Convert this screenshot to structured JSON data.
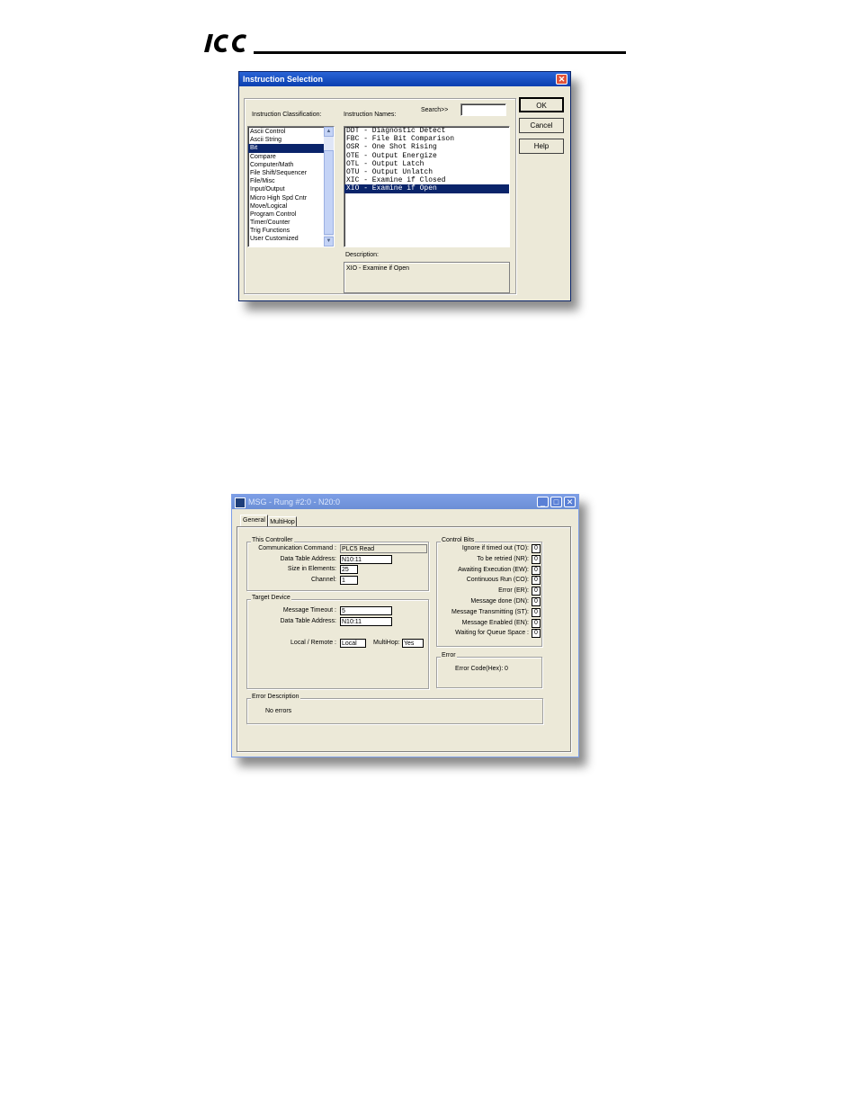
{
  "header": {
    "logo_text": "ICC"
  },
  "instruction_dialog": {
    "title": "Instruction Selection",
    "classification_label": "Instruction Classification:",
    "names_label": "Instruction Names:",
    "search_label": "Search>>",
    "search_value": "",
    "classifications": [
      {
        "label": "Ascii Control",
        "selected": false
      },
      {
        "label": "Ascii String",
        "selected": false
      },
      {
        "label": "Bit",
        "selected": true
      },
      {
        "label": "Compare",
        "selected": false
      },
      {
        "label": "Computer/Math",
        "selected": false
      },
      {
        "label": "File Shift/Sequencer",
        "selected": false
      },
      {
        "label": "File/Misc",
        "selected": false
      },
      {
        "label": "Input/Output",
        "selected": false
      },
      {
        "label": "Micro High Spd Cntr",
        "selected": false
      },
      {
        "label": "Move/Logical",
        "selected": false
      },
      {
        "label": "Program Control",
        "selected": false
      },
      {
        "label": "Timer/Counter",
        "selected": false
      },
      {
        "label": "Trig Functions",
        "selected": false
      },
      {
        "label": "User Customized",
        "selected": false
      }
    ],
    "instructions": [
      {
        "label": "DDT - Diagnostic Detect",
        "selected": false
      },
      {
        "label": "FBC - File Bit Comparison",
        "selected": false
      },
      {
        "label": "OSR - One Shot Rising",
        "selected": false
      },
      {
        "label": "OTE - Output Energize",
        "selected": false
      },
      {
        "label": "OTL - Output Latch",
        "selected": false
      },
      {
        "label": "OTU - Output Unlatch",
        "selected": false
      },
      {
        "label": "XIC - Examine if Closed",
        "selected": false
      },
      {
        "label": "XIO - Examine if Open",
        "selected": true
      }
    ],
    "description_label": "Description:",
    "description_text": "XIO - Examine if Open",
    "buttons": {
      "ok": "OK",
      "cancel": "Cancel",
      "help": "Help"
    },
    "close_glyph": "✕"
  },
  "msg_dialog": {
    "title": "MSG - Rung #2:0 - N20:0",
    "tabs": [
      "General",
      "MultiHop"
    ],
    "this_controller": {
      "legend": "This Controller",
      "fields": [
        {
          "label": "Communication Command :",
          "value": "PLC5 Read"
        },
        {
          "label": "Data Table Address:",
          "value": "N10:11"
        },
        {
          "label": "Size in Elements:",
          "value": "25"
        },
        {
          "label": "Channel:",
          "value": "1"
        }
      ]
    },
    "target_device": {
      "legend": "Target Device",
      "timeout_label": "Message Timeout :",
      "timeout_value": "5",
      "address_label": "Data Table Address:",
      "address_value": "N10:11",
      "local_remote_label": "Local / Remote :",
      "local_remote_value": "Local",
      "multihop_label": "MultiHop:",
      "multihop_value": "Yes"
    },
    "control_bits": {
      "legend": "Control Bits",
      "bits": [
        {
          "label": "Ignore if timed out (TO):",
          "value": "0"
        },
        {
          "label": "To be retried (NR):",
          "value": "0"
        },
        {
          "label": "Awaiting Execution (EW):",
          "value": "0"
        },
        {
          "label": "Continuous Run (CO):",
          "value": "0"
        },
        {
          "label": "Error (ER):",
          "value": "0"
        },
        {
          "label": "Message done (DN):",
          "value": "0"
        },
        {
          "label": "Message Transmitting (ST):",
          "value": "0"
        },
        {
          "label": "Message Enabled (EN):",
          "value": "0"
        },
        {
          "label": "Waiting for Queue Space :",
          "value": "0"
        }
      ]
    },
    "error": {
      "legend": "Error",
      "code_label": "Error Code(Hex):",
      "code_value": "0"
    },
    "error_description": {
      "legend": "Error Description",
      "text": "No errors"
    },
    "window_buttons": {
      "minimize": "_",
      "maximize": "□",
      "close": "✕"
    }
  }
}
